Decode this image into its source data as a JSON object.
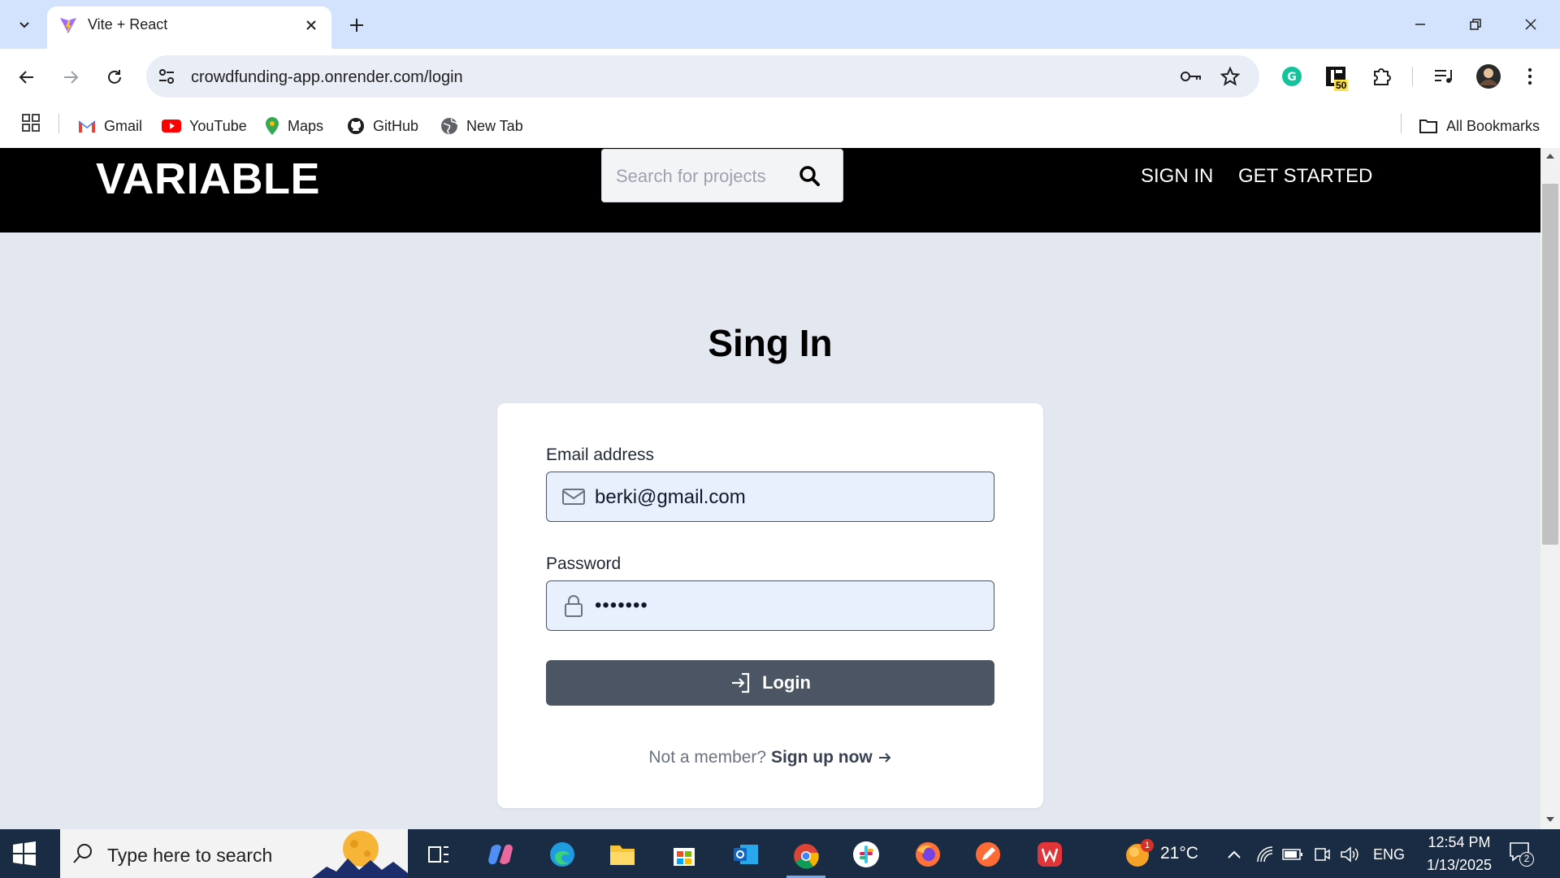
{
  "browser": {
    "tab_title": "Vite + React",
    "url": "crowdfunding-app.onrender.com/login",
    "extension_badge": "50",
    "bookmarks": [
      {
        "label": "Gmail"
      },
      {
        "label": "YouTube"
      },
      {
        "label": "Maps"
      },
      {
        "label": "GitHub"
      },
      {
        "label": "New Tab"
      }
    ],
    "all_bookmarks_label": "All Bookmarks"
  },
  "site": {
    "logo": "VARIABLE",
    "search_placeholder": "Search for projects",
    "nav_signin": "SIGN IN",
    "nav_get_started": "GET STARTED"
  },
  "login": {
    "title": "Sing In",
    "email_label": "Email address",
    "email_value": "berki@gmail.com",
    "password_label": "Password",
    "password_value": "•••••••",
    "login_button": "Login",
    "not_member": "Not a member?",
    "signup_link": "Sign up now"
  },
  "taskbar": {
    "search_placeholder": "Type here to search",
    "weather_badge": "1",
    "temperature": "21°C",
    "language": "ENG",
    "time": "12:54 PM",
    "date": "1/13/2025",
    "notification_count": "2"
  },
  "colors": {
    "tabstrip": "#d3e3fd",
    "page_bg": "#e3e8f0",
    "header_bg": "#000000",
    "button_bg": "#4b5563",
    "field_bg": "#e8f0fe",
    "taskbar_bg": "#1a2b44"
  }
}
